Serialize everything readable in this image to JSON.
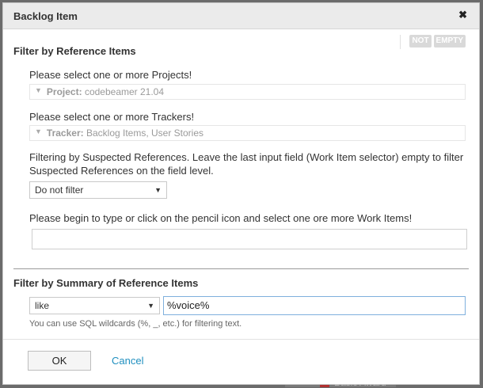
{
  "dialog": {
    "title": "Backlog Item",
    "close_glyph": "✖"
  },
  "toggles": {
    "not": "NOT",
    "empty": "EMPTY"
  },
  "reference_section": {
    "title": "Filter by Reference Items",
    "projects_label": "Please select one or more Projects!",
    "project_key": "Project:",
    "project_value": "codebeamer 21.04",
    "trackers_label": "Please select one or more Trackers!",
    "tracker_key": "Tracker:",
    "tracker_value": "Backlog Items, User Stories",
    "suspected_label": "Filtering by Suspected References. Leave the last input field (Work Item selector) empty to filter Suspected References on the field level.",
    "suspected_select": "Do not filter",
    "work_items_label": "Please begin to type or click on the pencil icon and select one ore more Work Items!",
    "work_items_value": ""
  },
  "summary_section": {
    "title": "Filter by Summary of Reference Items",
    "operator": "like",
    "value": "%voice%",
    "hint": "You can use SQL wildcards (%, _, etc.) for filtering text."
  },
  "footer": {
    "ok": "OK",
    "cancel": "Cancel"
  },
  "background": {
    "partial_text": "Basic Award"
  },
  "icons": {
    "close": "close-icon",
    "dropdown": "chevron-down-icon",
    "expand": "triangle-down-icon"
  }
}
